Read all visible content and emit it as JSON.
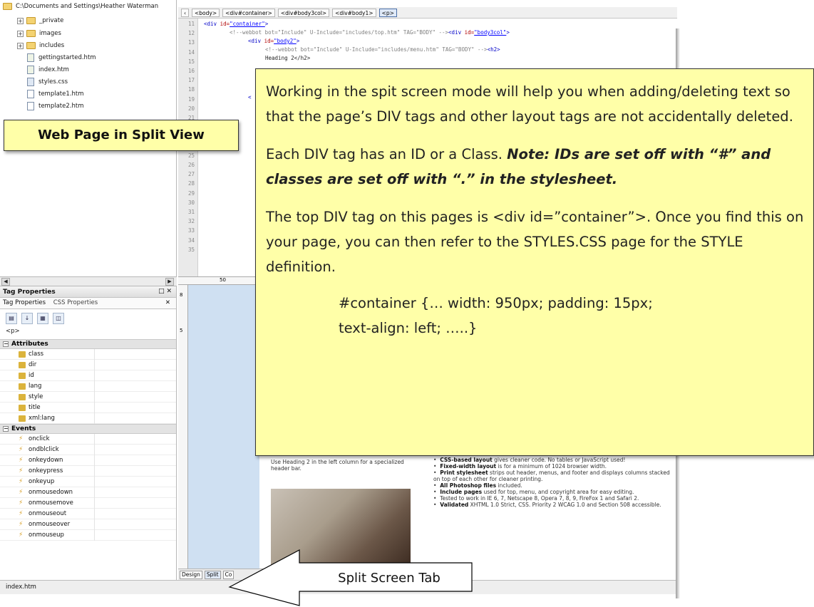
{
  "folder_list": {
    "root_path": "C:\\Documents and Settings\\Heather Waterman",
    "items": [
      {
        "name": "_private",
        "kind": "folder"
      },
      {
        "name": "images",
        "kind": "folder"
      },
      {
        "name": "includes",
        "kind": "folder"
      },
      {
        "name": "gettingstarted.htm",
        "kind": "file"
      },
      {
        "name": "index.htm",
        "kind": "file"
      },
      {
        "name": "styles.css",
        "kind": "file"
      },
      {
        "name": "template1.htm",
        "kind": "file"
      },
      {
        "name": "template2.htm",
        "kind": "file"
      }
    ]
  },
  "breadcrumb": [
    "<body>",
    "<div#container>",
    "<div#body3col>",
    "<div#body1>",
    "<p>"
  ],
  "code": {
    "line_numbers": [
      "11",
      "12",
      "13",
      "14",
      "15",
      "16",
      "17",
      "18",
      "19",
      "20",
      "21",
      "22",
      "23",
      "24",
      "25",
      "26",
      "27",
      "28",
      "29",
      "30",
      "31",
      "32",
      "33",
      "34",
      "35"
    ],
    "line11": {
      "tag": "<div",
      "attr": " id=",
      "val": "\"container\"",
      "end": ">"
    },
    "line12": {
      "comment": "<!--webbot bot=\"Include\" U-Include=\"includes/top.htm\" TAG=\"BODY\" -->",
      "tag": "<div",
      "attr": " id=",
      "val": "\"body3col\"",
      "end": ">"
    },
    "line13": {
      "tag": "<div",
      "attr": " id=",
      "val": "\"body2\"",
      "end": ">"
    },
    "line14": {
      "comment": "<!--webbot bot=\"Include\" U-Include=\"includes/menu.htm\" TAG=\"BODY\" -->",
      "tag": "<h2>"
    },
    "line15": "Heading 2</h2>"
  },
  "tag_properties": {
    "title": "Tag Properties",
    "tabs": [
      "Tag Properties",
      "CSS Properties"
    ],
    "selected_tag": "<p>",
    "attributes_label": "Attributes",
    "attributes": [
      "class",
      "dir",
      "id",
      "lang",
      "style",
      "title",
      "xml:lang"
    ],
    "events_label": "Events",
    "events": [
      "onclick",
      "ondblclick",
      "onkeydown",
      "onkeypress",
      "onkeyup",
      "onmousedown",
      "onmousemove",
      "onmouseout",
      "onmouseover",
      "onmouseup"
    ]
  },
  "design_view": {
    "left_text": "Use Heading 2 in the left column for a specialized header bar.",
    "bullets": [
      {
        "bold": "CSS-based layout",
        "text": " gives cleaner code. No tables or JavaScript used!"
      },
      {
        "bold": "Fixed-width layout",
        "text": " is for a minimum of 1024 browser width."
      },
      {
        "bold": "Print stylesheet",
        "text": " strips out header, menus, and footer and displays columns stacked on top of each other for cleaner printing."
      },
      {
        "bold": "All Photoshop files",
        "text": " included."
      },
      {
        "bold": "Include pages",
        "text": " used for top, menu, and copyright area for easy editing."
      },
      {
        "bold": "",
        "text": "Tested to work in IE 6, 7, Netscape 8, Opera 7, 8, 9, FireFox 1 and Safari 2."
      },
      {
        "bold": "Validated",
        "text": " XHTML 1.0 Strict, CSS. Priority 2 WCAG 1.0 and Section 508 accessible."
      }
    ]
  },
  "view_tabs": [
    "Design",
    "Split",
    "Co"
  ],
  "status_bar": "index.htm",
  "ruler_marks": [
    "50",
    "8",
    "5"
  ],
  "callouts": {
    "split_view_label": "Web Page in Split View",
    "note_p1": "Working in the spit screen mode will help you when adding/deleting text so that the page’s DIV tags and other layout tags are not accidentally deleted.",
    "note_p2_plain": "Each DIV tag has an ID or a Class.  ",
    "note_p2_em": "Note: IDs are set off with “#” and classes are set off with “.” in the stylesheet.",
    "note_p3": "The top DIV tag on this pages is <div id=”container”>. Once you find this on your page, you can then refer to the STYLES.CSS page for the STYLE definition.",
    "code_line1": "#container {… width: 950px; padding: 15px;",
    "code_line2": "text-align: left; …..}",
    "split_tab_label": "Split Screen Tab"
  },
  "colors": {
    "callout_bg": "#ffffa8",
    "design_bg": "#cfe0f2",
    "tag_color": "#0000c8"
  }
}
